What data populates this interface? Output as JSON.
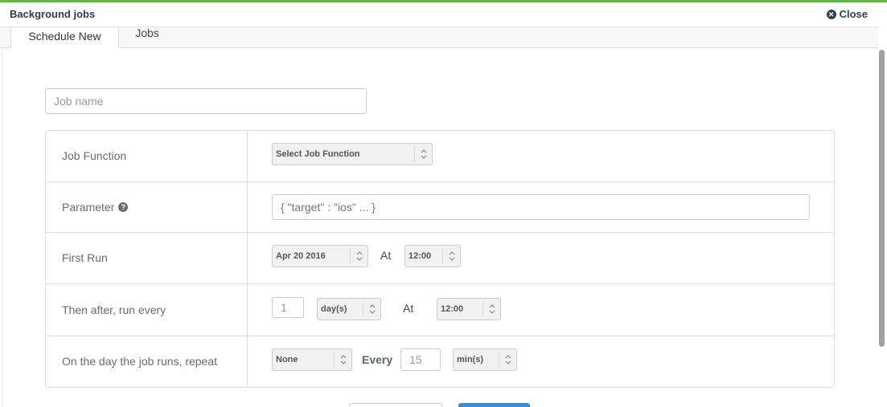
{
  "window": {
    "title": "Background jobs",
    "close_label": "Close"
  },
  "tabs": [
    {
      "label": "Schedule New",
      "active": true
    },
    {
      "label": "Jobs",
      "active": false
    }
  ],
  "form": {
    "job_name_placeholder": "Job name",
    "rows": {
      "job_function": {
        "label": "Job Function",
        "select_value": "Select Job Function"
      },
      "parameter": {
        "label": "Parameter",
        "placeholder": "{ \"target\" : \"ios\" ... }"
      },
      "first_run": {
        "label": "First Run",
        "date_value": "Apr 20 2016",
        "at_label": "At",
        "time_value": "12:00"
      },
      "then_after": {
        "label": "Then after, run every",
        "interval_value": "1",
        "unit_value": "day(s)",
        "at_label": "At",
        "time_value": "12:00"
      },
      "repeat": {
        "label": "On the day the job runs, repeat",
        "repeat_value": "None",
        "every_label": "Every",
        "every_value": "15",
        "unit_value": "min(s)"
      }
    }
  },
  "colors": {
    "accent_top": "#6ab04c",
    "title": "#2a3f54",
    "primary_button": "#3b8ed6"
  },
  "icons": {
    "close": "times-circle-icon",
    "help": "question-circle-icon",
    "select_arrows": "chevron-up-down-icon"
  }
}
